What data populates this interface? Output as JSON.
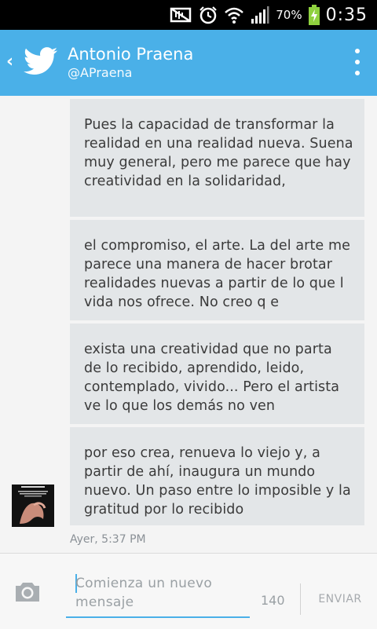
{
  "status_bar": {
    "battery": "70%",
    "time": "0:35",
    "icons": [
      "mute-icon",
      "alarm-icon",
      "wifi-icon",
      "signal-icon",
      "battery-charging-icon"
    ]
  },
  "header": {
    "name": "Antonio Praena",
    "handle": "@APraena",
    "icons": [
      "back-chevron-icon",
      "twitter-bird-icon",
      "overflow-menu-icon"
    ]
  },
  "messages": [
    {
      "text": "Pues la capacidad de transformar la realidad en una realidad nueva. Suena muy general, pero me parece que hay creatividad en la solidaridad,"
    },
    {
      "text": "el compromiso, el arte. La del arte me parece una manera de hacer brotar realidades nuevas a partir de lo que l vida nos ofrece. No creo q e"
    },
    {
      "text": "exista una creatividad que no parta de lo recibido, aprendido, leido, contemplado, vivido... Pero el artista ve lo que los demás no ven"
    },
    {
      "text": "por eso crea, renueva lo viejo y, a partir de ahí, inaugura un mundo nuevo. Un paso entre lo imposible y la gratitud por lo recibido"
    }
  ],
  "timestamp": "Ayer, 5:37 PM",
  "composer": {
    "placeholder": "Comienza un nuevo mensaje",
    "char_count": "140",
    "send_label": "ENVIAR"
  },
  "colors": {
    "accent": "#4ab0e8",
    "bubble": "#e3e6e8",
    "background": "#f4f4f4"
  }
}
